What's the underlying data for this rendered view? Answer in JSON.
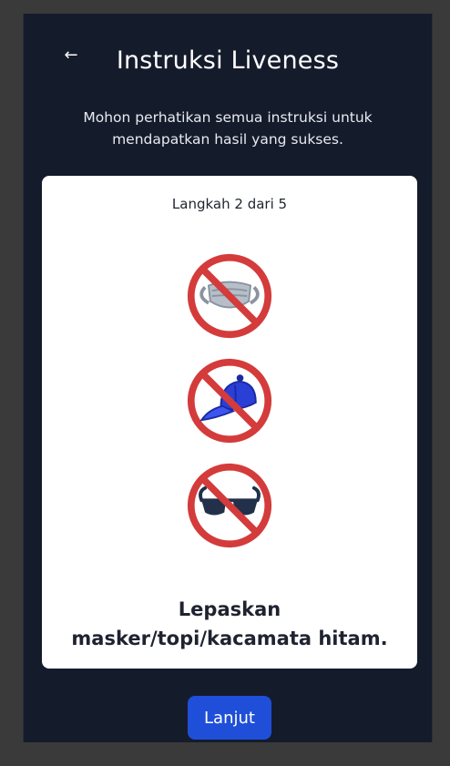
{
  "header": {
    "back_label": "←",
    "title": "Instruksi Liveness",
    "subtitle": "Mohon perhatikan semua instruksi untuk mendapatkan hasil yang sukses."
  },
  "card": {
    "step_text": "Langkah 2 dari 5",
    "icons": [
      "no-mask-icon",
      "no-cap-icon",
      "no-sunglasses-icon"
    ],
    "instruction": "Lepaskan masker/topi/kacamata hitam."
  },
  "actions": {
    "next_label": "Lanjut"
  },
  "colors": {
    "background": "#141b2b",
    "card": "#ffffff",
    "accent": "#1f4fd8",
    "prohibit_red": "#d43b3b"
  }
}
